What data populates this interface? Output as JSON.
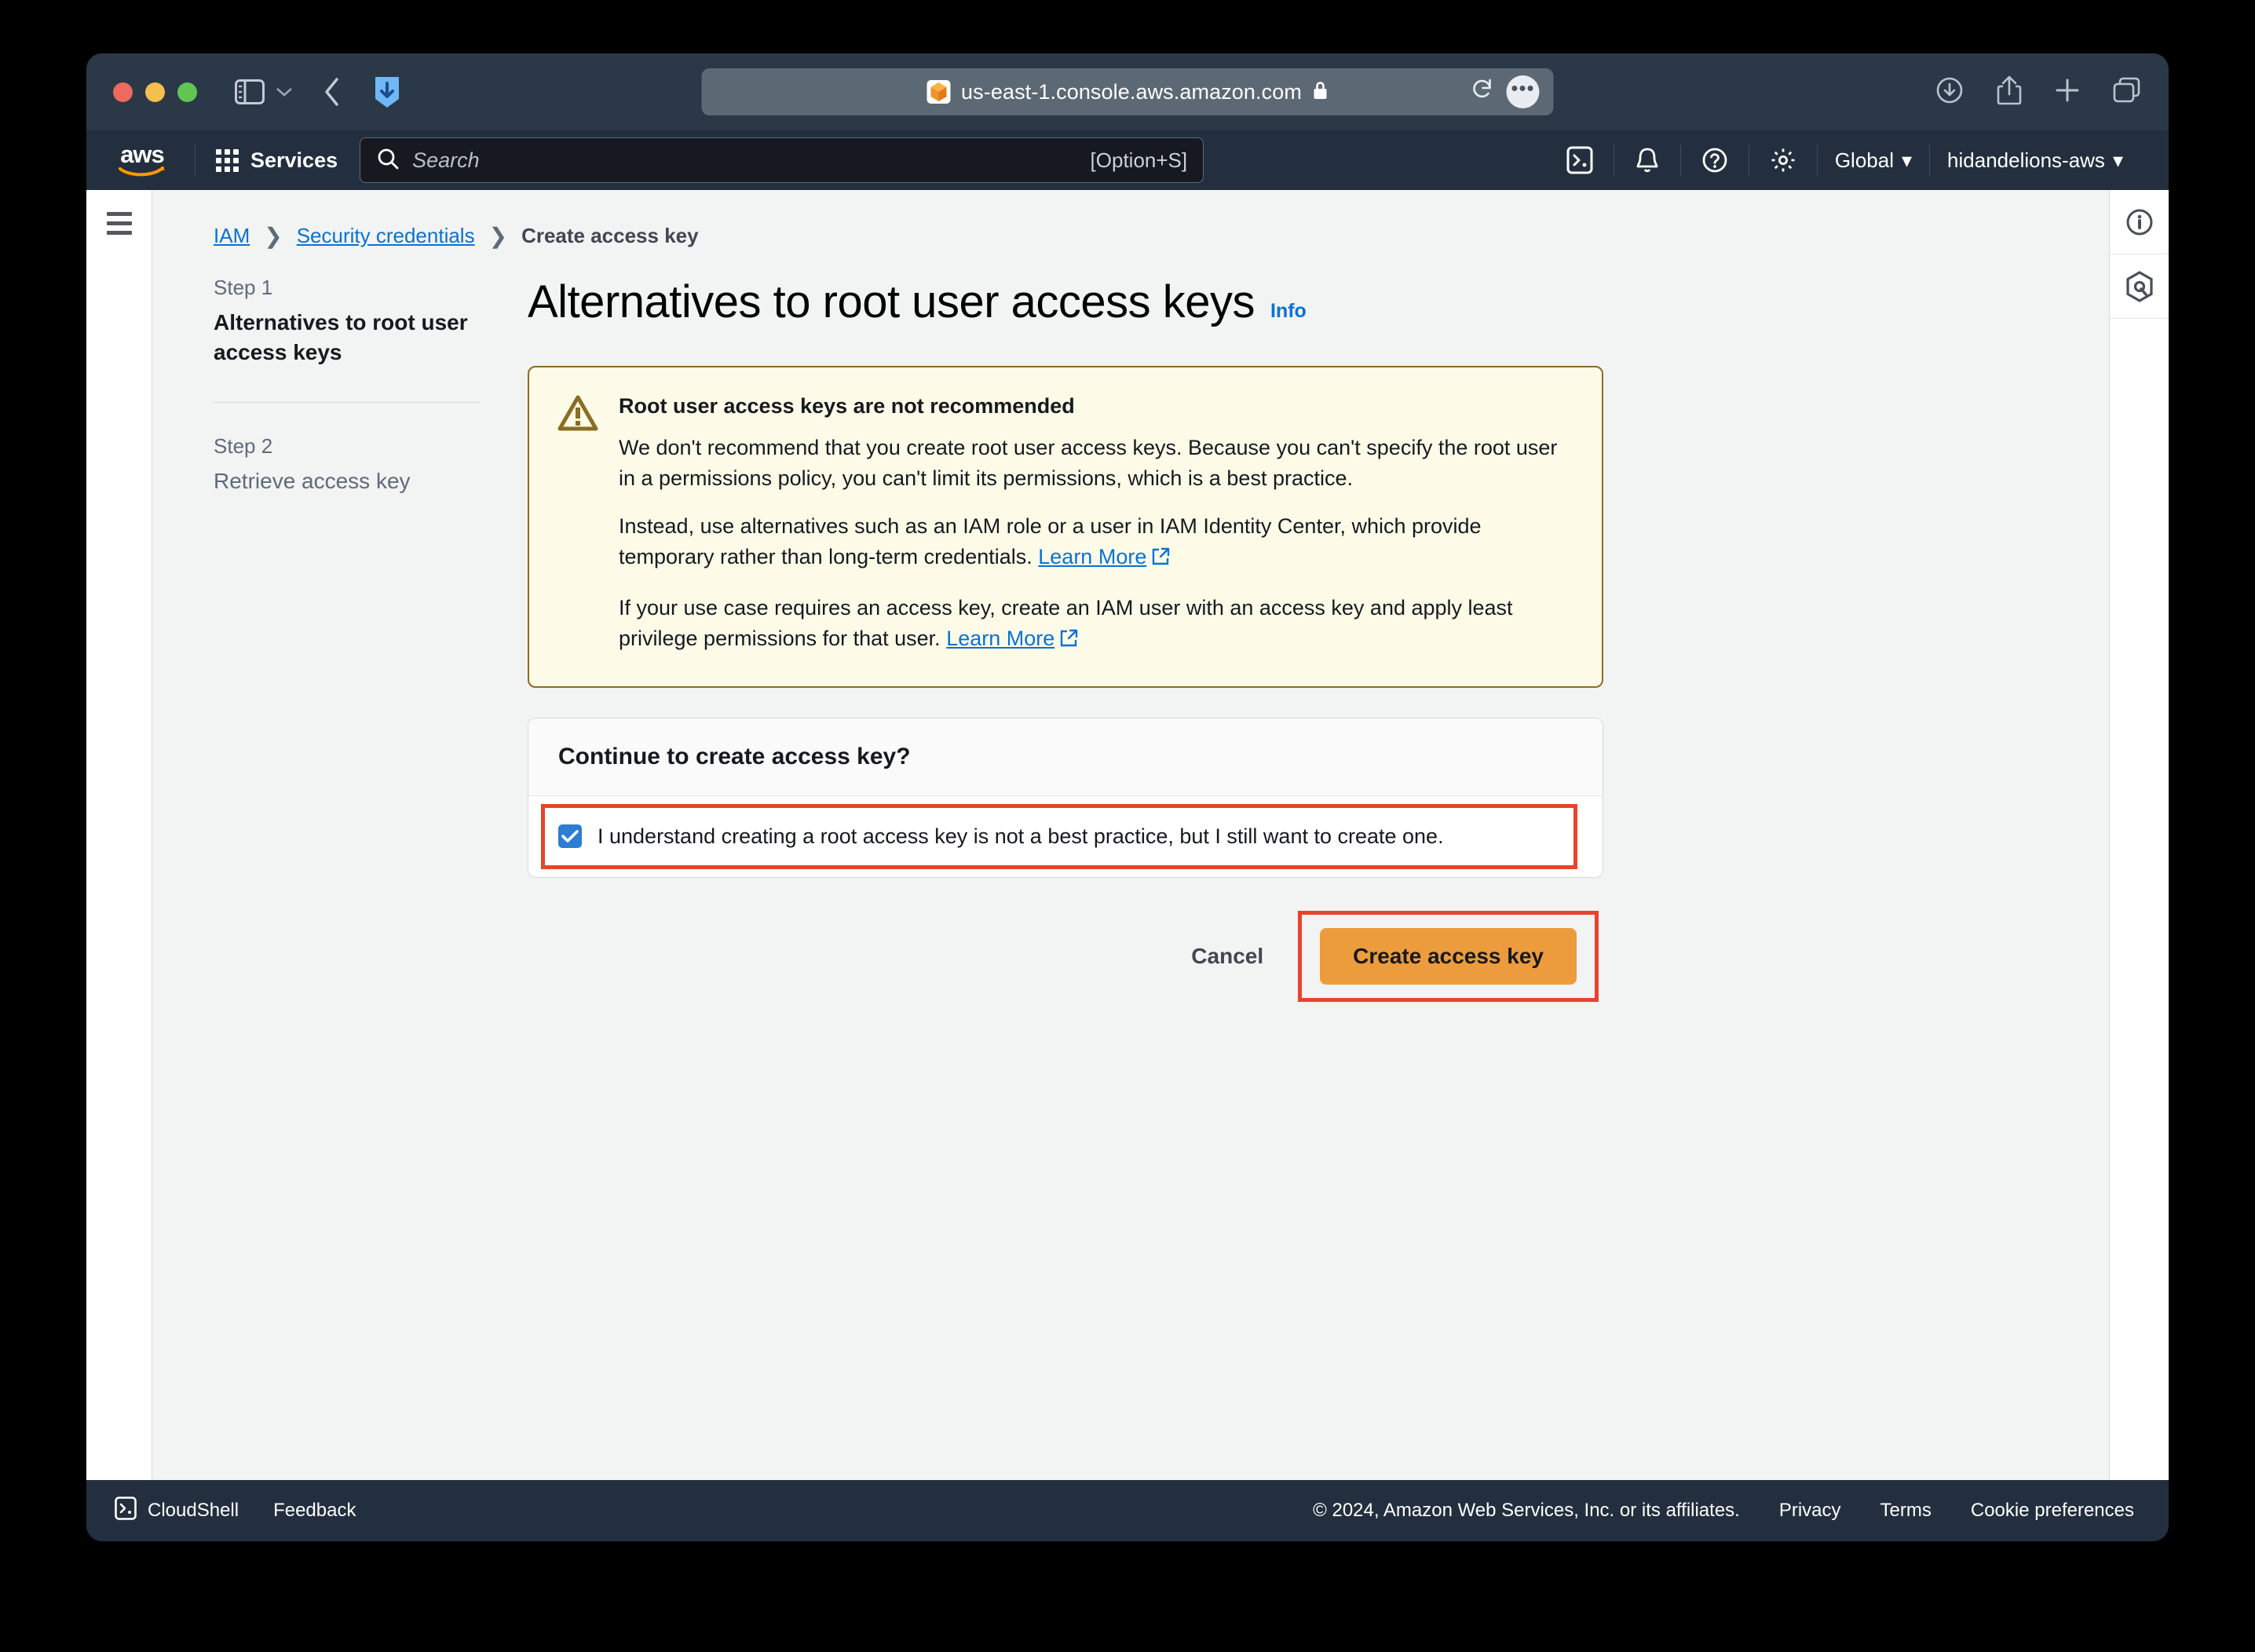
{
  "browser": {
    "url": "us-east-1.console.aws.amazon.com",
    "icons": {
      "sidebar": "sidebar-toggle-icon",
      "chevron": "chevron-down-icon",
      "back": "back-arrow-icon",
      "favicon": "aws-favicon",
      "lock": "lock-icon",
      "reload": "reload-icon",
      "more": "more-options-icon",
      "downloads": "downloads-icon",
      "share": "share-icon",
      "newtab": "new-tab-icon",
      "tabs": "tab-overview-icon"
    }
  },
  "nav": {
    "logo_text": "aws",
    "services_label": "Services",
    "search_placeholder": "Search",
    "search_value": "",
    "search_shortcut": "[Option+S]",
    "region_label": "Global",
    "account_label": "hidandelions-aws",
    "icons": {
      "grid": "services-grid-icon",
      "search": "search-icon",
      "cloudshell": "cloudshell-icon",
      "notifications": "bell-icon",
      "help": "help-circle-icon",
      "settings": "gear-icon",
      "caret": "caret-down-icon"
    }
  },
  "breadcrumb": {
    "items": [
      {
        "label": "IAM",
        "link": true
      },
      {
        "label": "Security credentials",
        "link": true
      },
      {
        "label": "Create access key",
        "link": false
      }
    ],
    "separator": "❯"
  },
  "steps": [
    {
      "num": "Step 1",
      "title": "Alternatives to root user access keys",
      "active": true
    },
    {
      "num": "Step 2",
      "title": "Retrieve access key",
      "active": false
    }
  ],
  "page": {
    "title": "Alternatives to root user access keys",
    "info_label": "Info"
  },
  "alert": {
    "icon": "warning-triangle-icon",
    "title": "Root user access keys are not recommended",
    "paragraph_1": "We don't recommend that you create root user access keys. Because you can't specify the root user in a permissions policy, you can't limit its permissions, which is a best practice.",
    "paragraph_2_text": "Instead, use alternatives such as an IAM role or a user in IAM Identity Center, which provide temporary rather than long-term credentials.",
    "paragraph_2_link": "Learn More",
    "paragraph_3_text": "If your use case requires an access key, create an IAM user with an access key and apply least privilege permissions for that user.",
    "paragraph_3_link": "Learn More",
    "bg_color": "#fdfbe8",
    "border_color": "#8a6d24"
  },
  "card": {
    "heading": "Continue to create access key?",
    "checkbox_label": "I understand creating a root access key is not a best practice, but I still want to create one.",
    "checkbox_checked": true,
    "checkbox_color": "#2d7dd2"
  },
  "actions": {
    "cancel_label": "Cancel",
    "primary_label": "Create access key",
    "primary_color": "#ec9c3d",
    "highlight_color": "#e8432a"
  },
  "right_rail": {
    "info_icon": "info-circle-icon",
    "assistant_icon": "aws-q-hexagon-icon"
  },
  "footer": {
    "cloudshell": "CloudShell",
    "feedback": "Feedback",
    "copyright": "© 2024, Amazon Web Services, Inc. or its affiliates.",
    "links": [
      "Privacy",
      "Terms",
      "Cookie preferences"
    ]
  }
}
